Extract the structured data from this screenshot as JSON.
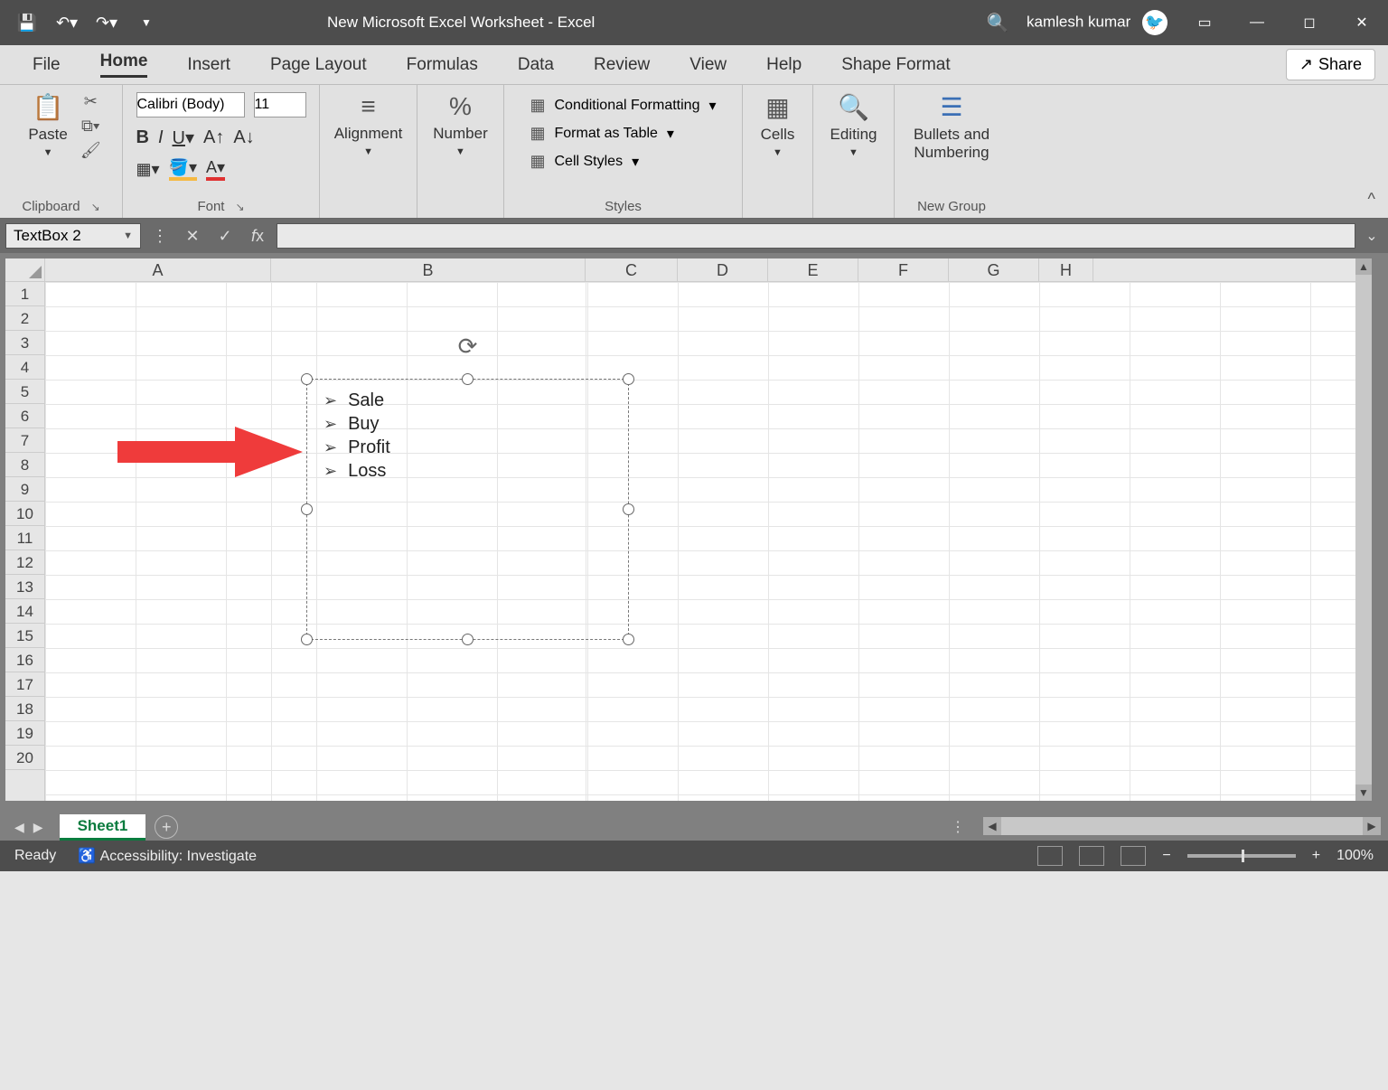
{
  "title": {
    "doc": "New Microsoft Excel Worksheet",
    "app": " -  Excel"
  },
  "user": "kamlesh kumar",
  "tabs": [
    "File",
    "Home",
    "Insert",
    "Page Layout",
    "Formulas",
    "Data",
    "Review",
    "View",
    "Help",
    "Shape Format"
  ],
  "active_tab": "Home",
  "share": "Share",
  "ribbon": {
    "clipboard": {
      "paste": "Paste",
      "label": "Clipboard"
    },
    "font": {
      "name": "Calibri (Body)",
      "size": "11",
      "label": "Font"
    },
    "alignment": {
      "label": "Alignment"
    },
    "number": {
      "label": "Number"
    },
    "styles": {
      "cond": "Conditional Formatting",
      "table": "Format as Table",
      "cell": "Cell Styles",
      "label": "Styles"
    },
    "cells": {
      "label": "Cells"
    },
    "editing": {
      "label": "Editing"
    },
    "newgroup": {
      "btn": "Bullets and Numbering",
      "label": "New Group"
    }
  },
  "namebox": "TextBox 2",
  "columns": [
    "A",
    "B",
    "C",
    "D",
    "E",
    "F",
    "G",
    "H"
  ],
  "rows": [
    "1",
    "2",
    "3",
    "4",
    "5",
    "6",
    "7",
    "8",
    "9",
    "10",
    "11",
    "12",
    "13",
    "14",
    "15",
    "16",
    "17",
    "18",
    "19",
    "20"
  ],
  "textbox_items": [
    "Sale",
    "Buy",
    "Profit",
    "Loss"
  ],
  "sheet": {
    "name": "Sheet1"
  },
  "status": {
    "ready": "Ready",
    "acc": "Accessibility: Investigate",
    "zoom": "100%"
  }
}
